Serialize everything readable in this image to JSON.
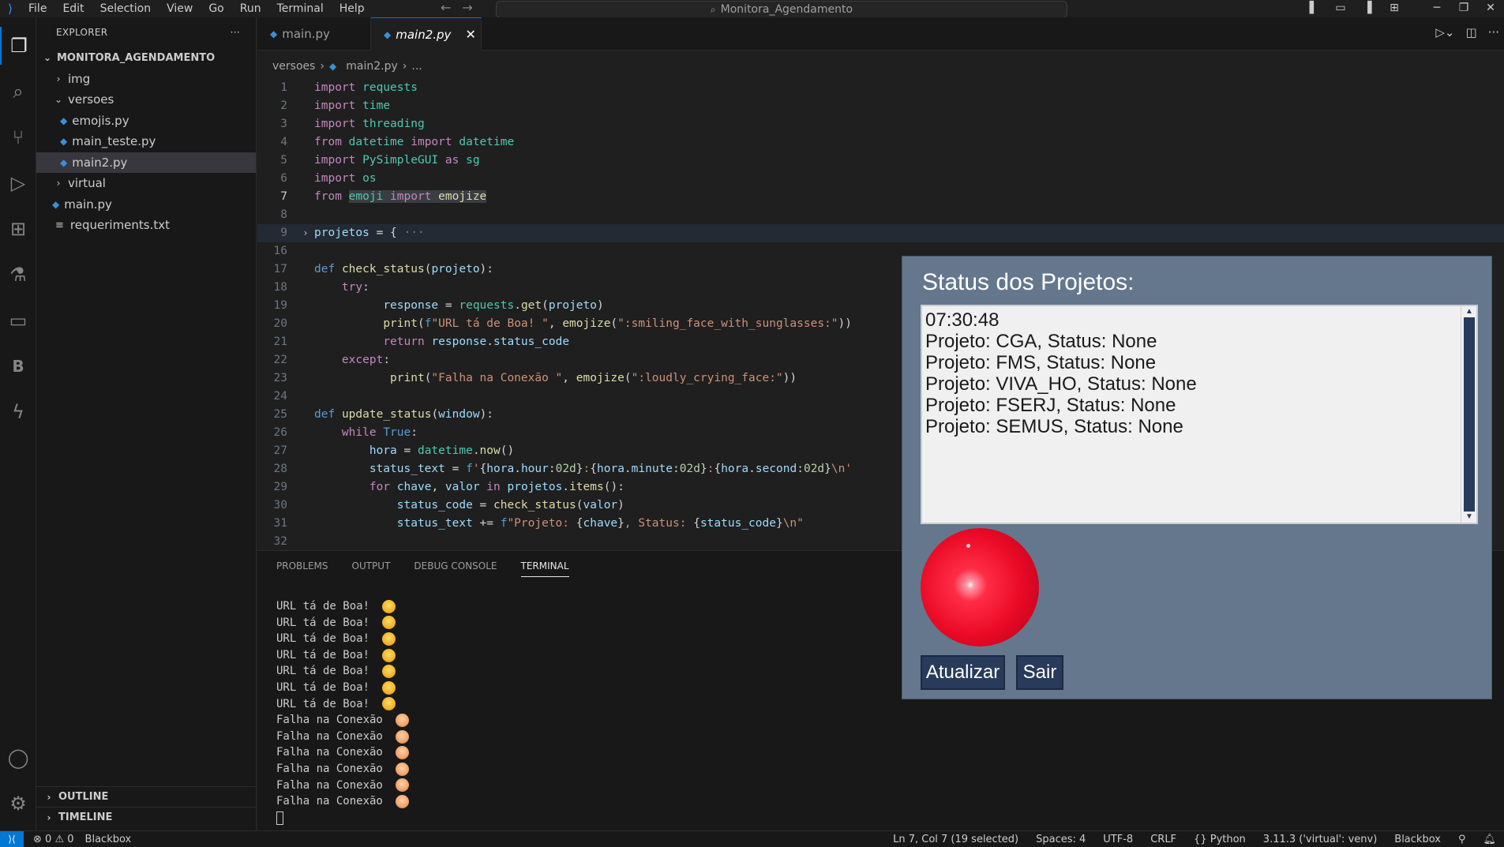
{
  "menu": [
    "File",
    "Edit",
    "Selection",
    "View",
    "Go",
    "Run",
    "Terminal",
    "Help"
  ],
  "command_center": "Monitora_Agendamento",
  "explorer": {
    "title": "EXPLORER",
    "root": "MONITORA_AGENDAMENTO",
    "items": {
      "img": "img",
      "versoes": "versoes",
      "emojis": "emojis.py",
      "main_teste": "main_teste.py",
      "main2": "main2.py",
      "virtual": "virtual",
      "main": "main.py",
      "req": "requeriments.txt"
    },
    "outline": "OUTLINE",
    "timeline": "TIMELINE"
  },
  "tabs": {
    "t1": "main.py",
    "t2": "main2.py"
  },
  "breadcrumb": {
    "folder": "versoes",
    "file": "main2.py",
    "more": "..."
  },
  "editor_lines": [
    "1",
    "2",
    "3",
    "4",
    "5",
    "6",
    "7",
    "8",
    "9",
    "16",
    "17",
    "18",
    "19",
    "20",
    "21",
    "22",
    "23",
    "24",
    "25",
    "26",
    "27",
    "28",
    "29",
    "30",
    "31",
    "32"
  ],
  "panel_tabs": {
    "problems": "PROBLEMS",
    "output": "OUTPUT",
    "debug": "DEBUG CONSOLE",
    "terminal": "TERMINAL"
  },
  "terminal": {
    "ok": "URL tá de Boa!",
    "fail": "Falha na Conexão"
  },
  "statusbar": {
    "errors": "0",
    "warnings": "0",
    "blackbox": "Blackbox",
    "position": "Ln 7, Col 7 (19 selected)",
    "spaces": "Spaces: 4",
    "encoding": "UTF-8",
    "eol": "CRLF",
    "language": "Python",
    "interpreter": "3.11.3 ('virtual': venv)",
    "blackbox2": "Blackbox"
  },
  "psg_window": {
    "title": "Status dos Projetos:",
    "output": "07:30:48\nProjeto: CGA, Status: None\nProjeto: FMS, Status: None\nProjeto: VIVA_HO, Status: None\nProjeto: FSERJ, Status: None\nProjeto: SEMUS, Status: None",
    "btn_update": "Atualizar",
    "btn_exit": "Sair",
    "indicator_color": "#ea0a26",
    "bg_color": "#64778d",
    "button_color": "#283b5b"
  },
  "colors": {
    "accent": "#0078d4",
    "editor_bg": "#1f1f1f",
    "sidebar_bg": "#181818"
  }
}
